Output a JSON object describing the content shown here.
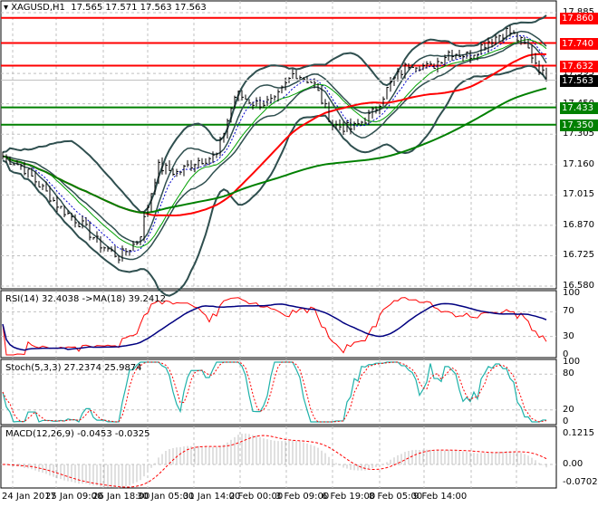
{
  "header": {
    "symbol": "XAGUSD,H1",
    "ohlc": "17.565 17.571 17.563 17.563"
  },
  "colors": {
    "resistance": "#ff0000",
    "support": "#008000",
    "price_tag": "#000000",
    "ma_fast": "#ff0000",
    "ma_slow": "#008000",
    "bands": "#2f4f4f",
    "rsi": "#ff0000",
    "rsi_ma": "#000080",
    "stoch_main": "#20b2aa",
    "stoch_signal": "#ff0000",
    "macd_hist": "#c0c0c0"
  },
  "chart_data": [
    {
      "type": "line",
      "title": "XAGUSD,H1",
      "ylim": [
        16.58,
        17.885
      ],
      "yticks": [
        "17.885",
        "17.740",
        "17.595",
        "17.450",
        "17.305",
        "17.160",
        "17.015",
        "16.870",
        "16.725",
        "16.580"
      ],
      "x": [
        "24 Jan 2017",
        "25 Jan 09:00",
        "26 Jan 18:00",
        "30 Jan 05:00",
        "31 Jan 14:00",
        "2 Feb 00:00",
        "3 Feb 09:00",
        "6 Feb 19:00",
        "8 Feb 05:00",
        "9 Feb 14:00"
      ],
      "close_anchors": [
        17.2,
        17.15,
        17.05,
        16.95,
        16.88,
        16.78,
        16.72,
        16.8,
        17.15,
        17.12,
        17.18,
        17.2,
        17.5,
        17.45,
        17.46,
        17.6,
        17.55,
        17.35,
        17.33,
        17.4,
        17.55,
        17.65,
        17.62,
        17.7,
        17.68,
        17.75,
        17.8,
        17.72,
        17.563
      ],
      "levels": [
        {
          "value": "17.860",
          "kind": "resistance"
        },
        {
          "value": "17.740",
          "kind": "resistance"
        },
        {
          "value": "17.632",
          "kind": "resistance"
        },
        {
          "value": "17.433",
          "kind": "support"
        },
        {
          "value": "17.350",
          "kind": "support"
        }
      ],
      "last_price": "17.563"
    },
    {
      "type": "line",
      "title": "RSI(14) 32.4038  ->MA(18) 39.2412",
      "yticks": [
        "100",
        "70",
        "30",
        "0"
      ],
      "ylim": [
        0,
        100
      ]
    },
    {
      "type": "line",
      "title": "Stoch(5,3,3) 27.2374 25.9874",
      "yticks": [
        "100",
        "80",
        "20",
        "0"
      ],
      "ylim": [
        0,
        100
      ]
    },
    {
      "type": "bar",
      "title": "MACD(12,26,9) -0.0453 -0.0325",
      "yticks": [
        "0.1215",
        "0.00",
        "-0.0702"
      ],
      "ylim": [
        -0.0702,
        0.1215
      ]
    }
  ]
}
